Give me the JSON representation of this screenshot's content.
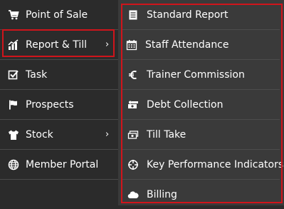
{
  "menu": {
    "items": [
      {
        "label": "Point of Sale",
        "icon": "cart-icon"
      },
      {
        "label": "Report & Till",
        "icon": "bar-chart-icon",
        "has_submenu": true
      },
      {
        "label": "Task",
        "icon": "checkbox-icon"
      },
      {
        "label": "Prospects",
        "icon": "flag-icon"
      },
      {
        "label": "Stock",
        "icon": "tshirt-icon",
        "has_submenu": true
      },
      {
        "label": "Member Portal",
        "icon": "globe-icon"
      }
    ],
    "chevron": "›"
  },
  "submenu": {
    "items": [
      {
        "label": "Standard Report",
        "icon": "document-icon"
      },
      {
        "label": "Staff Attendance",
        "icon": "calendar-icon"
      },
      {
        "label": "Trainer Commission",
        "icon": "euro-icon"
      },
      {
        "label": "Debt Collection",
        "icon": "money-icon"
      },
      {
        "label": "Till Take",
        "icon": "cash-register-icon"
      },
      {
        "label": "Key Performance Indicators",
        "icon": "crosshair-icon"
      },
      {
        "label": "Billing",
        "icon": "cloud-icon"
      }
    ]
  },
  "colors": {
    "highlight": "#d0141b",
    "menu_bg": "#2b2b2b",
    "submenu_bg": "#3a3a3a",
    "text": "#ffffff"
  }
}
